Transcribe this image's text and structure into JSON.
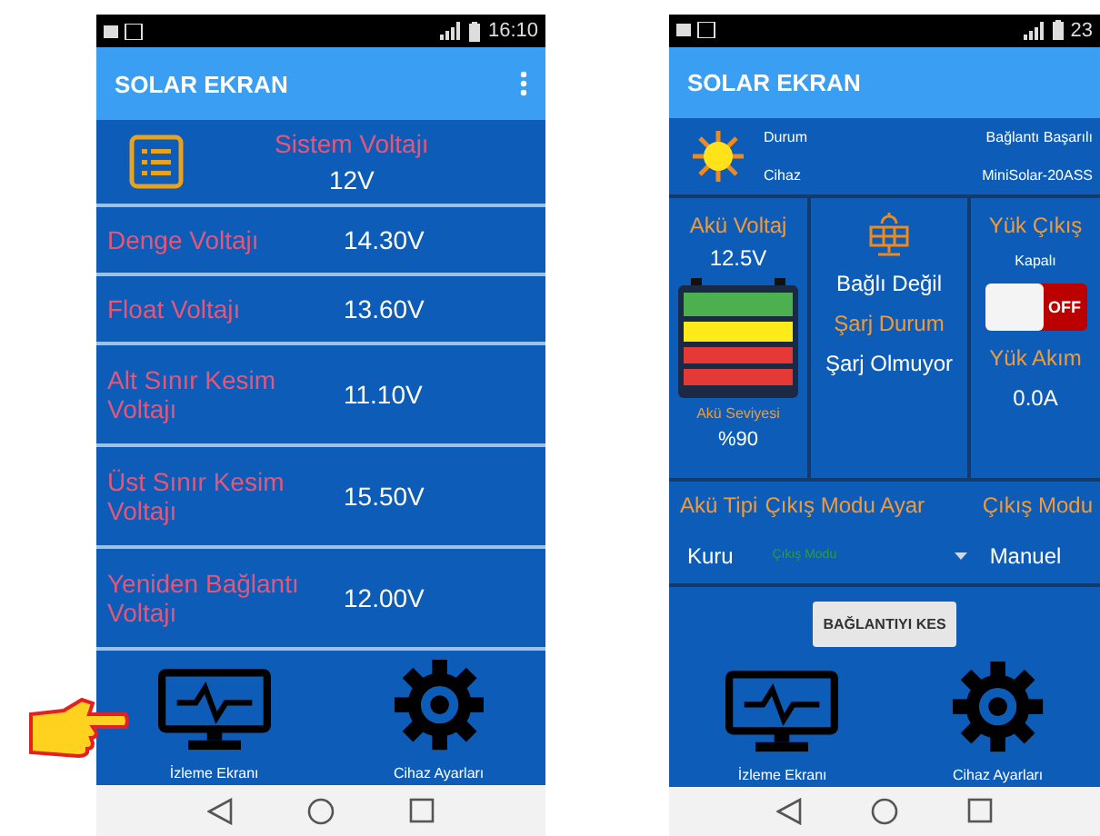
{
  "left_screen": {
    "status_bar": {
      "time": "16:10"
    },
    "app_bar": {
      "title": "SOLAR EKRAN"
    },
    "header": {
      "label": "Sistem Voltajı",
      "value": "12V"
    },
    "rows": [
      {
        "label": "Denge Voltajı",
        "value": "14.30V"
      },
      {
        "label": "Float Voltajı",
        "value": "13.60V"
      },
      {
        "label": "Alt Sınır Kesim Voltajı",
        "value": "11.10V"
      },
      {
        "label": "Üst Sınır Kesim Voltajı",
        "value": "15.50V"
      },
      {
        "label": "Yeniden Bağlantı Voltajı",
        "value": "12.00V"
      }
    ],
    "bottom_nav": [
      {
        "label": "İzleme Ekranı",
        "kind": "monitor"
      },
      {
        "label": "Cihaz Ayarları",
        "kind": "gear"
      }
    ]
  },
  "right_screen": {
    "status_bar": {
      "time": "23"
    },
    "app_bar": {
      "title": "SOLAR EKRAN"
    },
    "info": [
      {
        "label": "Durum",
        "value": "Bağlantı Başarılı"
      },
      {
        "label": "Cihaz",
        "value": "MiniSolar-20ASS"
      }
    ],
    "battery": {
      "label": "Akü Voltaj",
      "value": "12.5V",
      "level_label": "Akü Seviyesi",
      "level_value": "%90"
    },
    "panel": {
      "status": "Bağlı Değil",
      "charge_label": "Şarj Durum",
      "charge_value": "Şarj Olmuyor"
    },
    "load": {
      "label": "Yük Çıkış",
      "state": "Kapalı",
      "switch": {
        "on": false,
        "label": "OFF"
      },
      "current_label": "Yük Akım",
      "current_value": "0.0A"
    },
    "settings": [
      {
        "label": "Akü Tipi",
        "kind": "text",
        "value": "Kuru"
      },
      {
        "label": "Çıkış Modu Ayar",
        "kind": "dropdown",
        "placeholder": "Çıkış Modu"
      },
      {
        "label": "Çıkış Modu",
        "kind": "text",
        "value": "Manuel"
      }
    ],
    "button": "BAĞLANTIYI KES",
    "bottom_nav": [
      {
        "label": "İzleme Ekranı",
        "kind": "monitor"
      },
      {
        "label": "Cihaz Ayarları",
        "kind": "gear"
      }
    ]
  }
}
